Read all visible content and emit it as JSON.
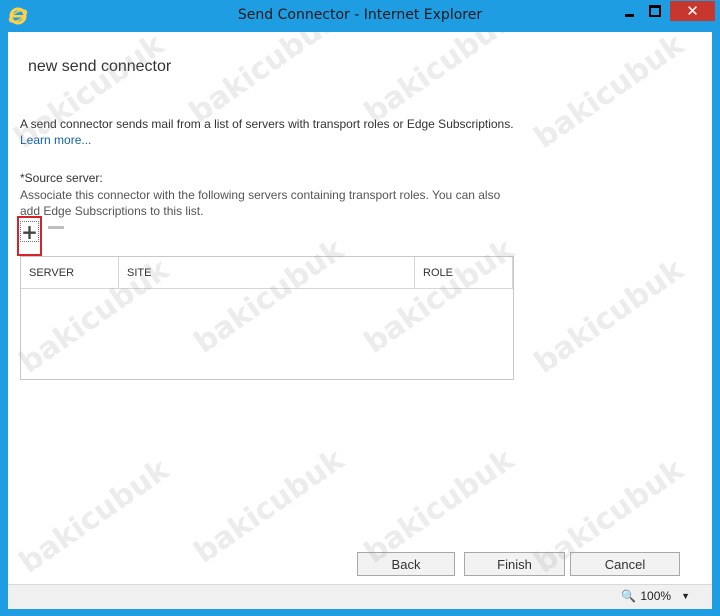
{
  "window": {
    "title": "Send Connector - Internet Explorer"
  },
  "page": {
    "title": "new send connector",
    "description": "A send connector sends mail from a list of servers with transport roles or Edge Subscriptions.",
    "learn_more": "Learn more...",
    "source_label": "*Source server:",
    "source_hint": "Associate this connector with the following servers containing transport roles. You can also add Edge Subscriptions to this list."
  },
  "table": {
    "columns": [
      "SERVER",
      "SITE",
      "ROLE"
    ],
    "rows": []
  },
  "buttons": {
    "back": "Back",
    "finish": "Finish",
    "cancel": "Cancel"
  },
  "statusbar": {
    "zoom": "100%"
  },
  "watermark": "bakicubuk",
  "colors": {
    "titlebar": "#1e9de3",
    "link": "#1462a8",
    "highlight": "#d4232b"
  },
  "icons": [
    "ie-icon",
    "minimize-icon",
    "maximize-icon",
    "close-icon",
    "add-icon",
    "remove-icon",
    "zoom-icon",
    "chevron-down-icon"
  ]
}
